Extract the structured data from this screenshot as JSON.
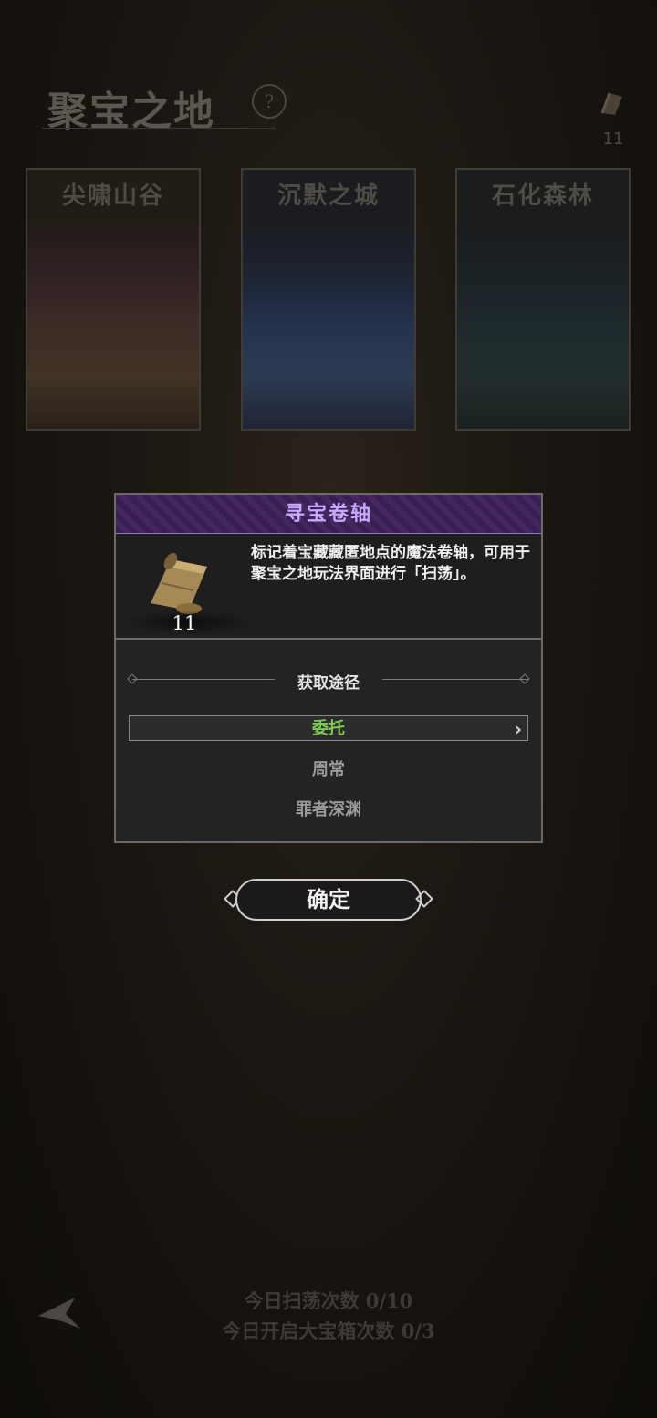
{
  "header": {
    "title": "聚宝之地",
    "help_icon": "help-icon",
    "resource_icon": "scroll-icon",
    "resource_count": "11"
  },
  "maps": [
    {
      "name": "尖啸山谷"
    },
    {
      "name": "沉默之城"
    },
    {
      "name": "石化森林"
    }
  ],
  "dialog": {
    "title": "寻宝卷轴",
    "item_count": "11",
    "description": "标记着宝藏藏匿地点的魔法卷轴，可用于聚宝之地玩法界面进行「扫荡」。",
    "section_title": "获取途径",
    "sources": [
      {
        "label": "委托",
        "selected": true
      },
      {
        "label": "周常",
        "selected": false
      },
      {
        "label": "罪者深渊",
        "selected": false
      }
    ],
    "colors": {
      "header": "#3a1f52",
      "title": "#c9a8ff",
      "selected_source": "#7dcc52"
    }
  },
  "confirm_label": "确定",
  "stats": {
    "sweep": "今日扫荡次数 0/10",
    "chest": "今日开启大宝箱次数 0/3"
  },
  "back_icon": "back-arrow-icon"
}
